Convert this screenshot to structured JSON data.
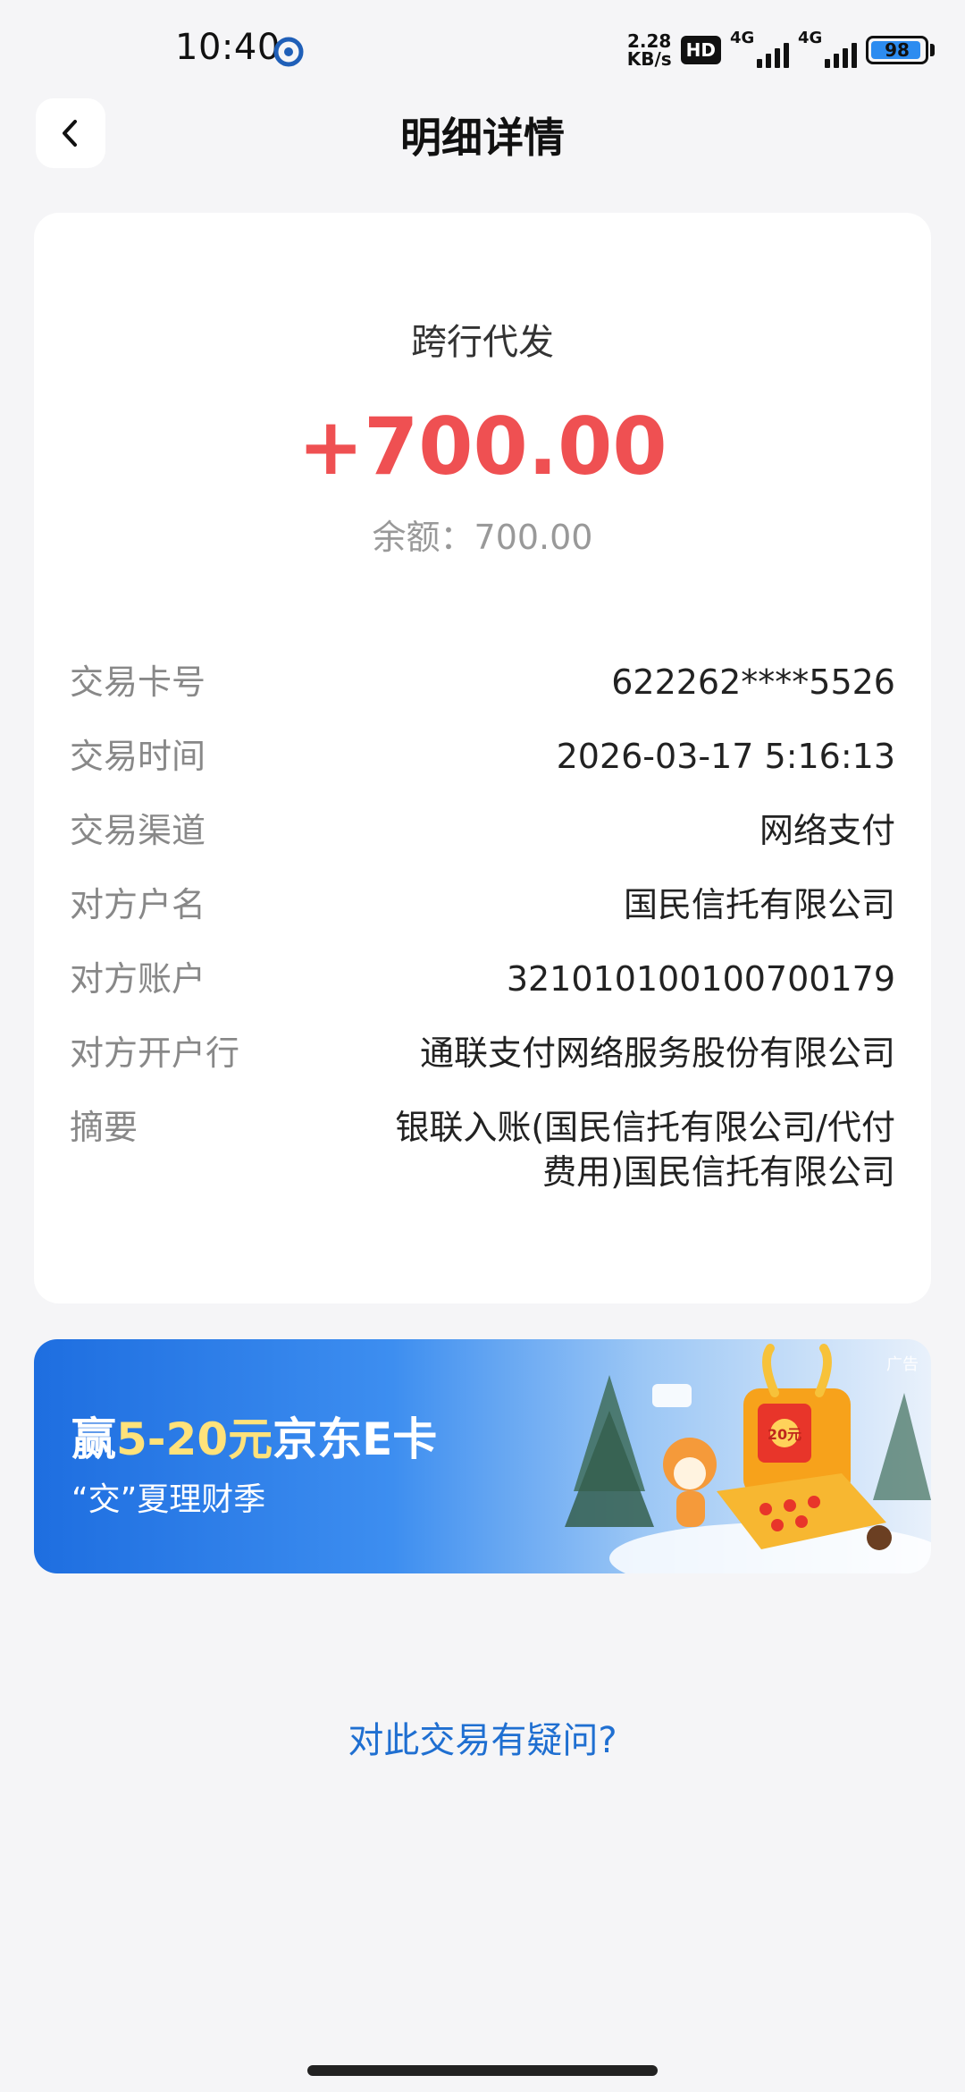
{
  "status_bar": {
    "time": "10:40",
    "net_speed_value": "2.28",
    "net_speed_unit": "KB/s",
    "hd_label": "HD",
    "signal_1_label": "4G",
    "signal_2_label": "4G",
    "battery": "98"
  },
  "header": {
    "title": "明细详情",
    "back_icon": "chevron-left-icon"
  },
  "transaction": {
    "type": "跨行代发",
    "amount": "+700.00",
    "balance": "余额：700.00",
    "rows": [
      {
        "label": "交易卡号",
        "value": "622262****5526"
      },
      {
        "label": "交易时间",
        "value": "2026-03-17 5:16:13"
      },
      {
        "label": "交易渠道",
        "value": "网络支付"
      },
      {
        "label": "对方户名",
        "value": "国民信托有限公司"
      },
      {
        "label": "对方账户",
        "value": "321010100100700179"
      },
      {
        "label": "对方开户行",
        "value": "通联支付网络服务股份有限公司"
      },
      {
        "label": "摘要",
        "value": "银联入账(国民信托有限公司/代付费用)国民信托有限公司"
      }
    ]
  },
  "promo": {
    "title_prefix": "赢",
    "title_highlight": "5-20元",
    "title_suffix": "京东E卡",
    "subtitle": "“交”夏理财季",
    "ad_tag": "广告",
    "art_label": "20元"
  },
  "help_link": "对此交易有疑问?",
  "colors": {
    "amount": "#ef5052",
    "link": "#1f6fd1",
    "promo_highlight": "#ffe27a"
  }
}
